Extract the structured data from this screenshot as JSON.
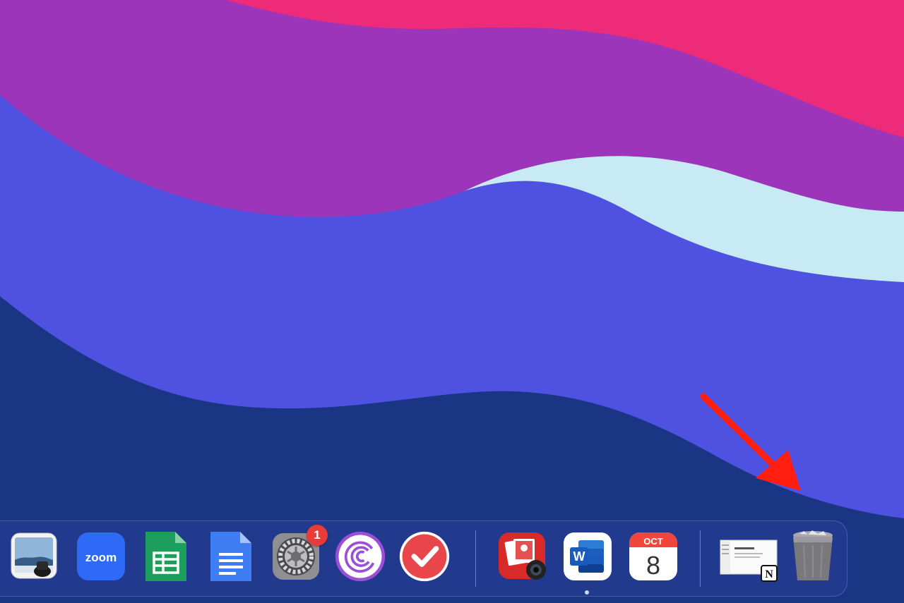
{
  "colors": {
    "wallpaper_pink": "#ee2b78",
    "wallpaper_purple": "#9c35ba",
    "wallpaper_blue": "#4f52e0",
    "wallpaper_navy": "#1b3585",
    "wallpaper_light": "#c8eaf4",
    "arrow": "#ff1e0f"
  },
  "dock": {
    "apps": [
      {
        "icon": "preview-icon"
      },
      {
        "icon": "zoom-icon",
        "label": "zoom"
      },
      {
        "icon": "google-sheets-icon"
      },
      {
        "icon": "google-docs-icon"
      },
      {
        "icon": "system-preferences-gear-icon",
        "badge": "1"
      },
      {
        "icon": "bittorrent-icon"
      },
      {
        "icon": "checkmark-todo-icon"
      },
      {
        "icon": "photo-booth-icon"
      },
      {
        "icon": "microsoft-word-icon",
        "label": "W"
      },
      {
        "icon": "calendar-icon",
        "month": "OCT",
        "day": "8"
      },
      {
        "icon": "notion-document-icon",
        "label": "N"
      },
      {
        "icon": "trash-icon"
      }
    ]
  },
  "annotation": {
    "icon": "red-arrow-icon"
  }
}
